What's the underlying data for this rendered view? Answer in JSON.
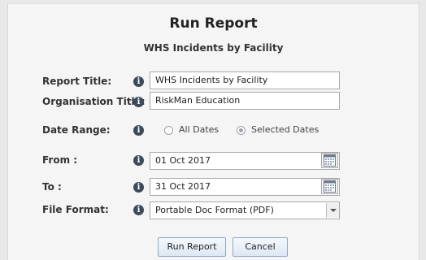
{
  "dialog": {
    "title": "Run Report",
    "subtitle": "WHS Incidents by Facility"
  },
  "form": {
    "report_title": {
      "label": "Report Title:",
      "value": "WHS Incidents by Facility"
    },
    "organisation_title": {
      "label": "Organisation Title:",
      "value": "RiskMan Education"
    },
    "date_range": {
      "label": "Date Range:",
      "option_all": "All Dates",
      "option_selected": "Selected Dates",
      "selected": "Selected Dates"
    },
    "from": {
      "label": "From :",
      "value": "01 Oct 2017"
    },
    "to": {
      "label": "To :",
      "value": "31 Oct 2017"
    },
    "file_format": {
      "label": "File Format:",
      "value": "Portable Doc Format (PDF)"
    }
  },
  "buttons": {
    "run": "Run Report",
    "cancel": "Cancel"
  },
  "icons": {
    "info": "i"
  }
}
